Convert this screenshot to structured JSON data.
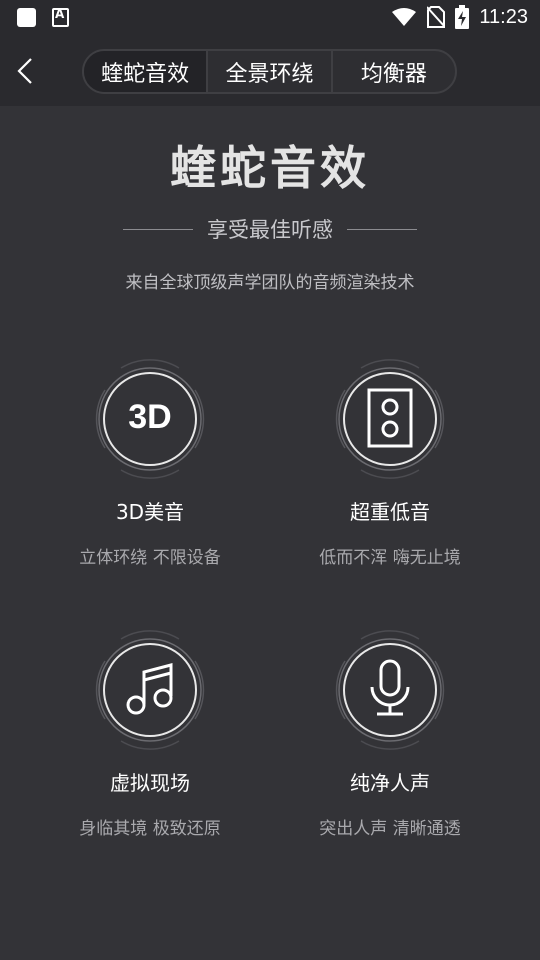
{
  "status_bar": {
    "time": "11:23",
    "app_icon_letter": "A",
    "icons": [
      "square-icon",
      "app-a-icon",
      "wifi-icon",
      "no-sim-icon",
      "battery-charging-icon"
    ]
  },
  "header": {
    "back_icon": "chevron-left-icon",
    "tabs": [
      {
        "label": "蝰蛇音效",
        "active": true
      },
      {
        "label": "全景环绕",
        "active": false
      },
      {
        "label": "均衡器",
        "active": false
      }
    ]
  },
  "hero": {
    "title": "蝰蛇音效",
    "subtitle": "享受最佳听感",
    "description": "来自全球顶级声学团队的音频渲染技术"
  },
  "features": [
    {
      "icon": "3d-icon",
      "icon_text": "3D",
      "title": "3D美音",
      "desc": "立体环绕 不限设备"
    },
    {
      "icon": "speaker-icon",
      "title": "超重低音",
      "desc": "低而不浑 嗨无止境"
    },
    {
      "icon": "music-note-icon",
      "title": "虚拟现场",
      "desc": "身临其境 极致还原"
    },
    {
      "icon": "microphone-icon",
      "title": "纯净人声",
      "desc": "突出人声 清晰通透"
    }
  ],
  "colors": {
    "background": "#333337",
    "header": "#2a2a2e",
    "active_tab": "#232327"
  }
}
